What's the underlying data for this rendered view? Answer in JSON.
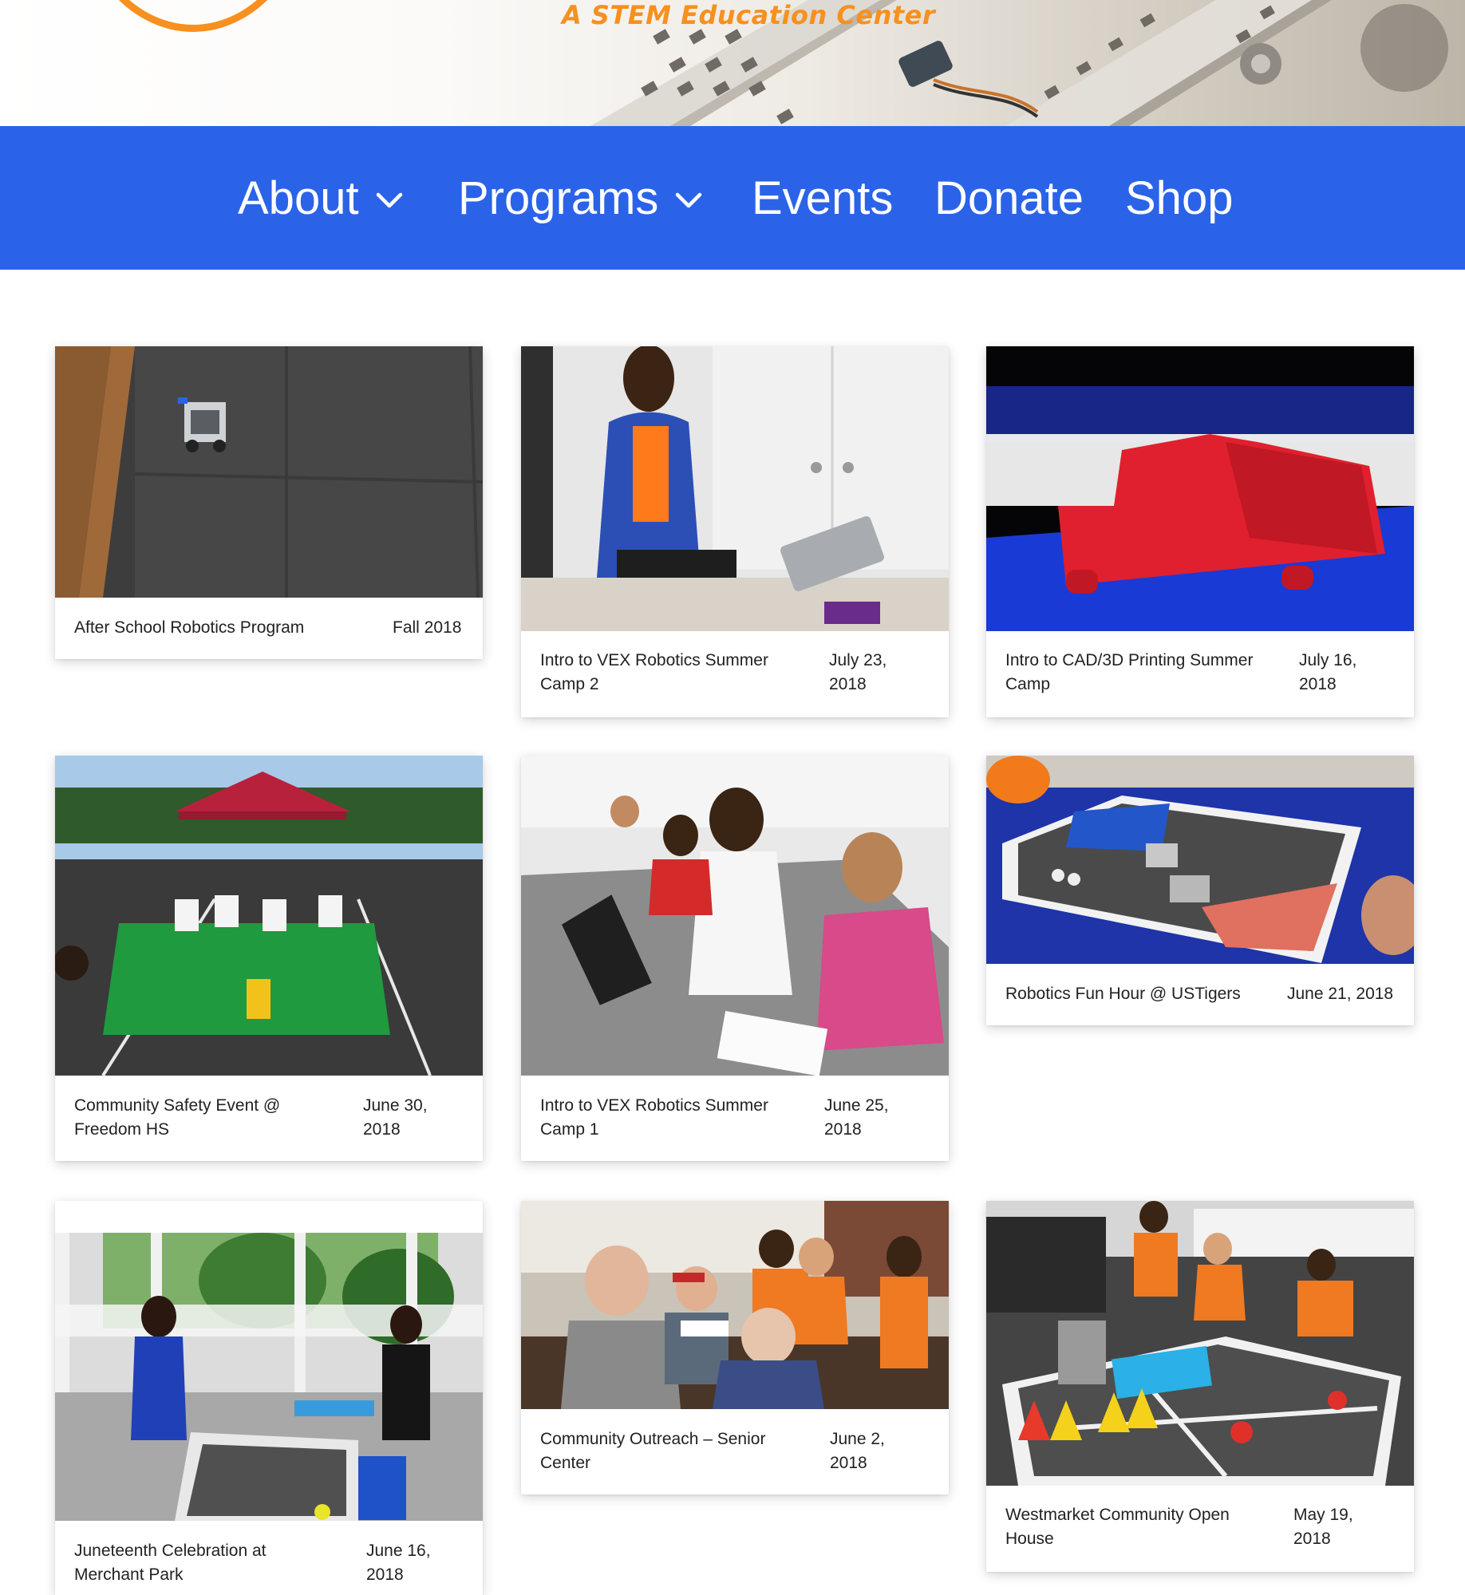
{
  "hero": {
    "tagline": "A STEM Education Center"
  },
  "nav": {
    "items": [
      {
        "label": "About",
        "has_dropdown": true
      },
      {
        "label": "Programs",
        "has_dropdown": true
      },
      {
        "label": "Events",
        "has_dropdown": false
      },
      {
        "label": "Donate",
        "has_dropdown": false
      },
      {
        "label": "Shop",
        "has_dropdown": false
      }
    ]
  },
  "colors": {
    "nav_bg": "#2b63e8",
    "accent_orange": "#f7901e",
    "card_bg": "#ffffff",
    "text": "#222222"
  },
  "events": [
    {
      "title": "After School Robotics Program",
      "date": "Fall 2018"
    },
    {
      "title": "Intro to VEX Robotics Summer Camp 2",
      "date": "July 23, 2018"
    },
    {
      "title": "Intro to CAD/3D Printing Summer Camp",
      "date": "July 16, 2018"
    },
    {
      "title": "Community Safety Event @ Freedom HS",
      "date": "June 30, 2018"
    },
    {
      "title": "Intro to VEX Robotics Summer Camp 1",
      "date": "June 25, 2018"
    },
    {
      "title": "Robotics Fun Hour @ USTigers",
      "date": "June 21, 2018"
    },
    {
      "title": "Juneteenth Celebration at Merchant Park",
      "date": "June 16, 2018"
    },
    {
      "title": "Community Outreach – Senior Center",
      "date": "June 2, 2018"
    },
    {
      "title": "Westmarket Community Open House",
      "date": "May 19, 2018"
    }
  ]
}
